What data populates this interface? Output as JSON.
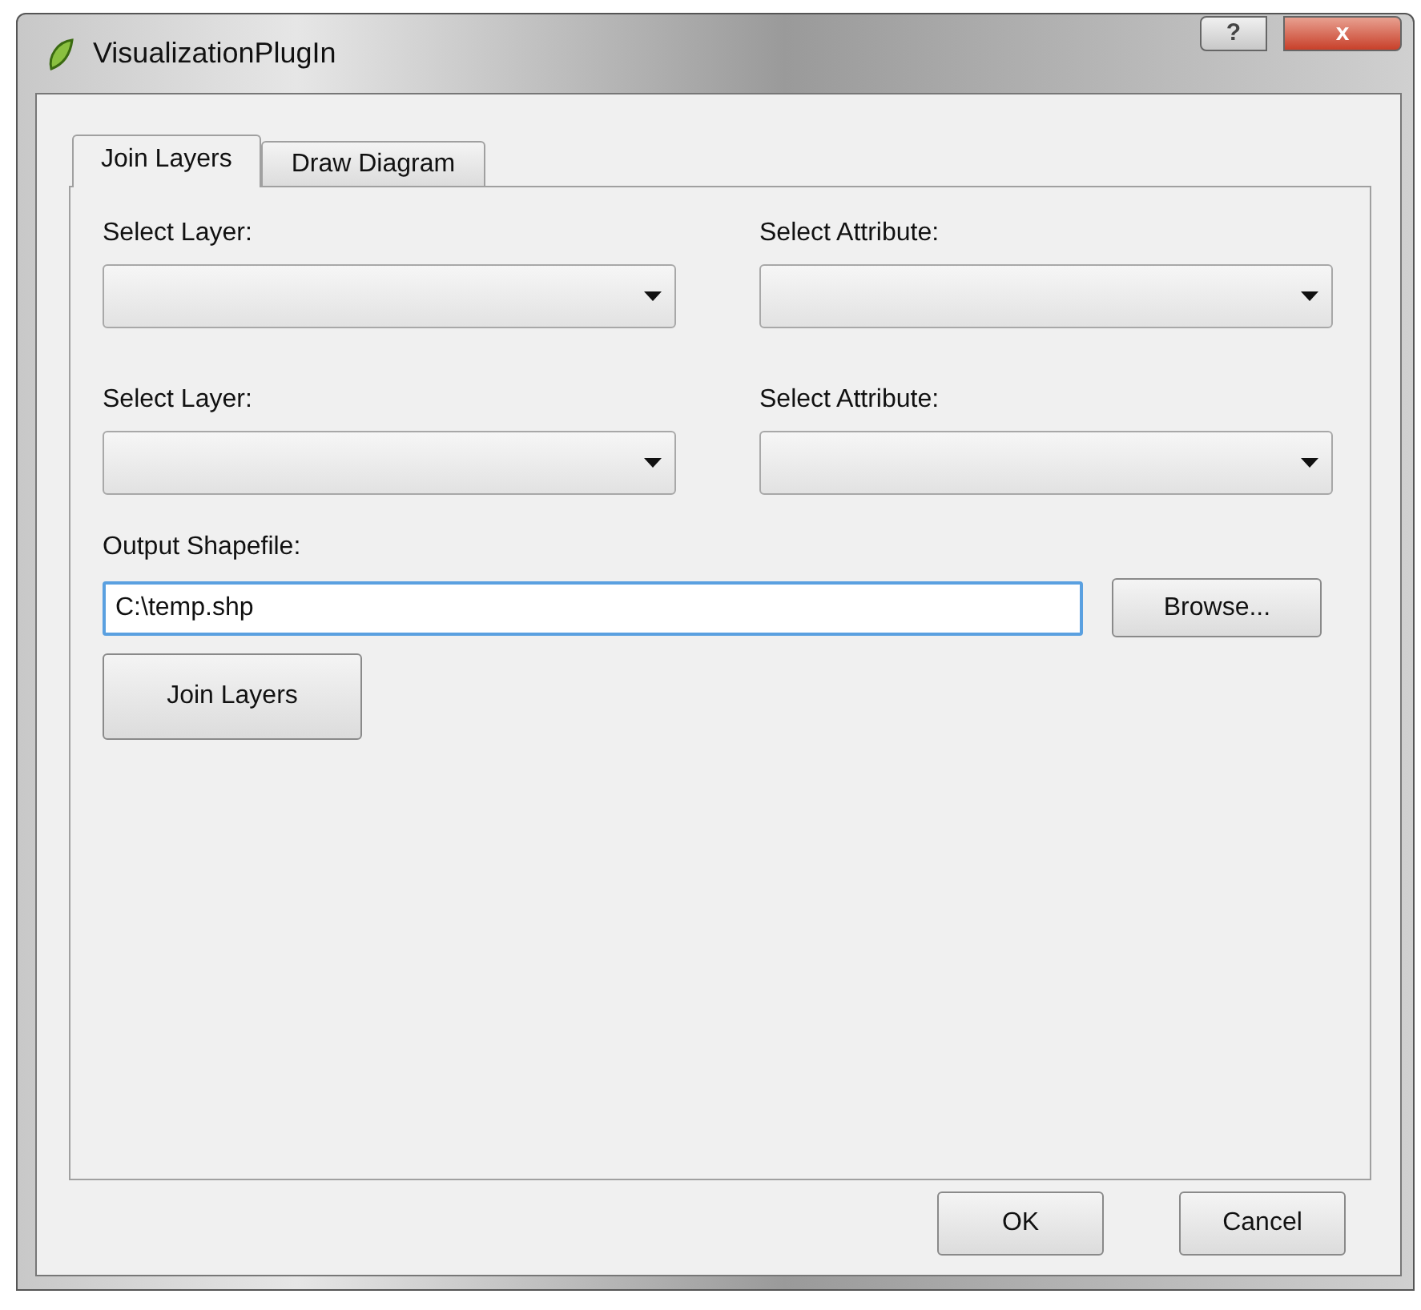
{
  "window": {
    "title": "VisualizationPlugIn",
    "help_button": "?",
    "close_button": "x"
  },
  "tabs": [
    {
      "label": "Join Layers",
      "selected": true
    },
    {
      "label": "Draw Diagram",
      "selected": false
    }
  ],
  "rows": [
    {
      "left_label": "Select Layer:",
      "right_label": "Select Attribute:"
    },
    {
      "left_label": "Select Layer:",
      "right_label": "Select Attribute:"
    }
  ],
  "output": {
    "label": "Output Shapefile:",
    "value": "C:\\temp.shp",
    "browse_button": "Browse..."
  },
  "join_button": "Join Layers",
  "buttons": [
    "OK",
    "Cancel"
  ]
}
